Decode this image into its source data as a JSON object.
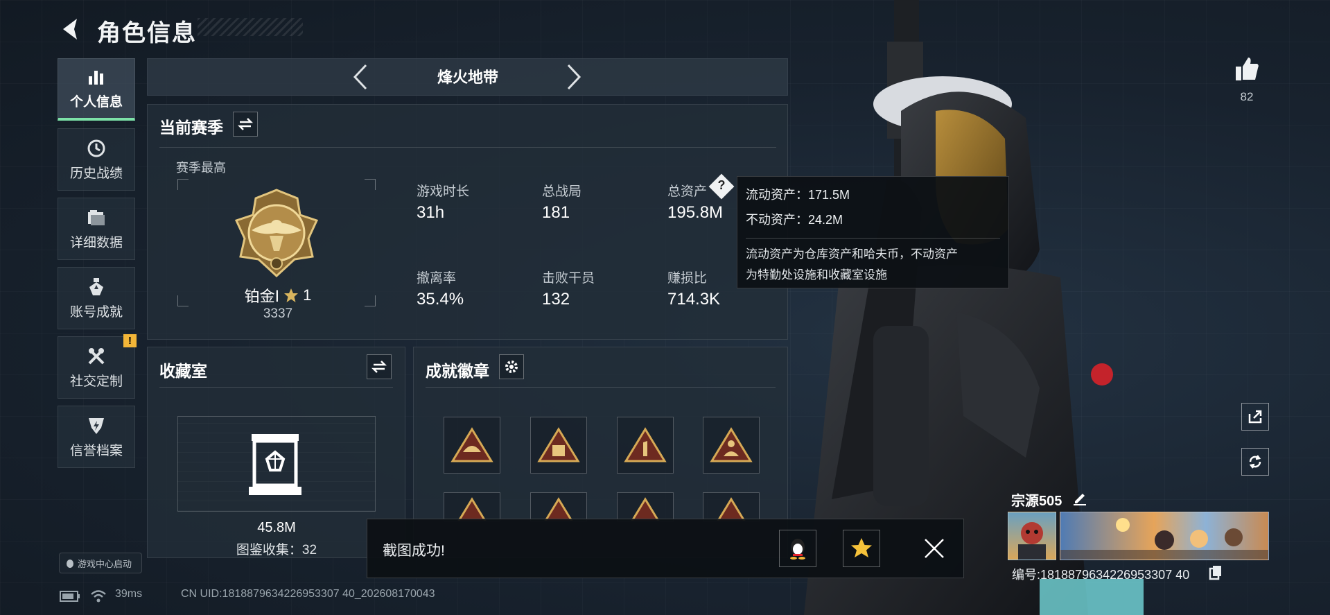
{
  "header": {
    "title": "角色信息"
  },
  "sidebar": {
    "items": [
      {
        "label": "个人信息"
      },
      {
        "label": "历史战绩"
      },
      {
        "label": "详细数据"
      },
      {
        "label": "账号成就"
      },
      {
        "label": "社交定制"
      },
      {
        "label": "信誉档案"
      }
    ],
    "warning_badge": "!",
    "launch_label": "游戏中心启动"
  },
  "mode": {
    "title": "烽火地带"
  },
  "season": {
    "title": "当前赛季",
    "best_label": "赛季最高",
    "rank_name": "铂金Ⅰ",
    "rank_stars": "1",
    "rank_score": "3337",
    "stats": [
      {
        "label": "游戏时长",
        "value": "31h"
      },
      {
        "label": "总战局",
        "value": "181"
      },
      {
        "label": "总资产",
        "value": "195.8M"
      },
      {
        "label": "撤离率",
        "value": "35.4%"
      },
      {
        "label": "击败干员",
        "value": "132"
      },
      {
        "label": "赚损比",
        "value": "714.3K"
      }
    ]
  },
  "tooltip": {
    "liquid": "流动资产：171.5M",
    "fixed": "不动资产：24.2M",
    "desc1": "流动资产为仓库资产和哈夫币，不动资产",
    "desc2": "为特勤处设施和收藏室设施"
  },
  "collection": {
    "title": "收藏室",
    "value": "45.8M",
    "count": "图鉴收集：32"
  },
  "achievements": {
    "title": "成就徽章"
  },
  "toast": {
    "text": "截图成功!"
  },
  "status": {
    "ping": "39ms",
    "uid": "CN UID:1818879634226953307 40_202608170043"
  },
  "right": {
    "likes": "82"
  },
  "player": {
    "name": "宗源505",
    "id": "编号:1818879634226953307 40"
  },
  "colors": {
    "accent": "#7de2a8",
    "warn": "#f3b638",
    "gold": "#c9a45c"
  }
}
